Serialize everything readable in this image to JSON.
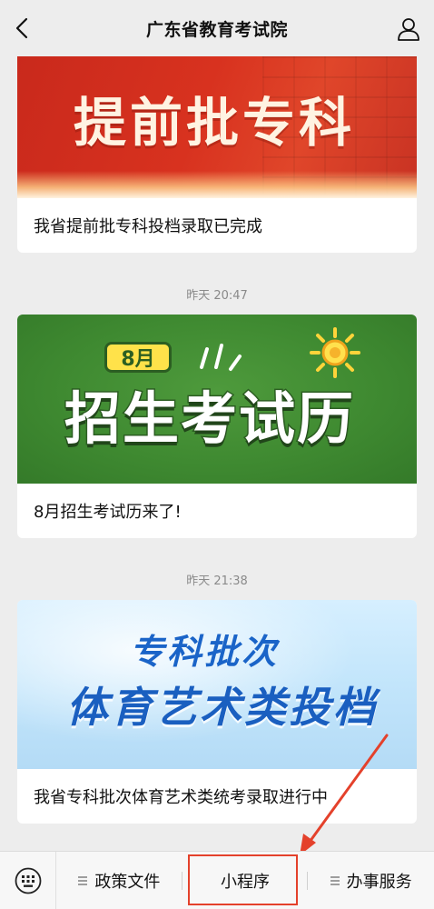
{
  "header": {
    "title": "广东省教育考试院",
    "back_icon": "chevron-left-icon",
    "profile_icon": "person-icon"
  },
  "articles": [
    {
      "banner_text": "提前批专科",
      "caption": "我省提前批专科投档录取已完成"
    },
    {
      "timestamp": "昨天 20:47",
      "banner_badge": "8月",
      "banner_text": "招生考试历",
      "caption": "8月招生考试历来了!"
    },
    {
      "timestamp": "昨天 21:38",
      "banner_line1": "专科批次",
      "banner_line2": "体育艺术类投档",
      "caption": "我省专科批次体育艺术类统考录取进行中"
    }
  ],
  "bottom_menu": {
    "keyboard_icon": "keyboard-icon",
    "items": [
      {
        "label": "政策文件",
        "icon": "menu-lines-icon"
      },
      {
        "label": "小程序"
      },
      {
        "label": "办事服务",
        "icon": "menu-lines-icon"
      }
    ]
  },
  "colors": {
    "background": "#ededed",
    "annotation_red": "#e4412b",
    "banner1": "#d8321f",
    "banner2": "#3f8a31",
    "banner3": "#c2e5fb"
  }
}
